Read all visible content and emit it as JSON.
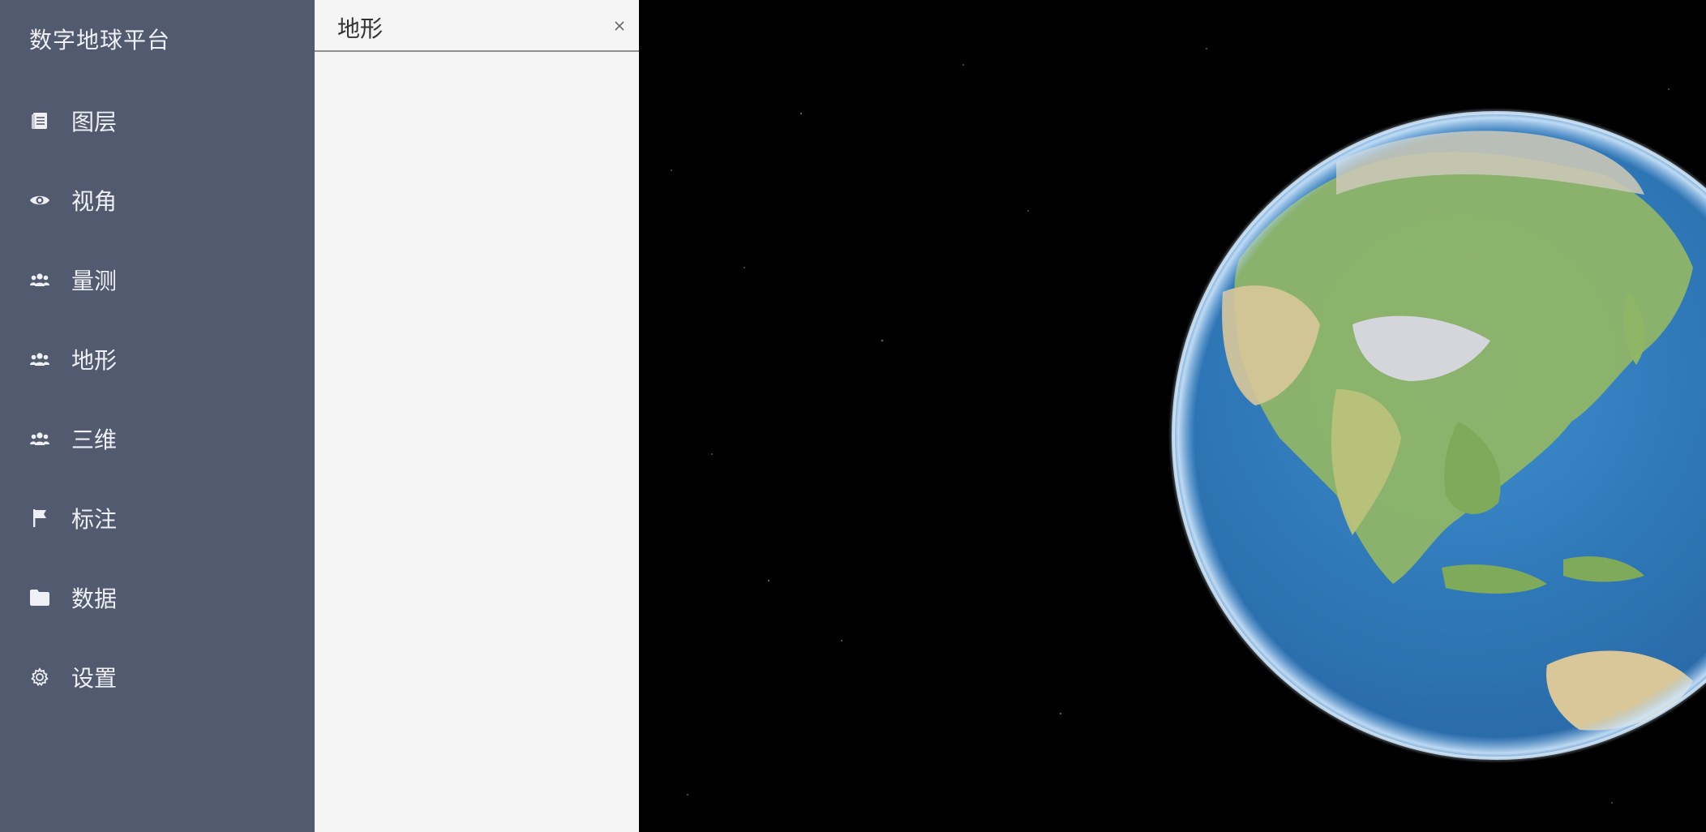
{
  "app": {
    "title": "数字地球平台"
  },
  "sidebar": {
    "items": [
      {
        "label": "图层",
        "icon": "layers-icon"
      },
      {
        "label": "视角",
        "icon": "eye-icon"
      },
      {
        "label": "量测",
        "icon": "users-icon"
      },
      {
        "label": "地形",
        "icon": "users-icon"
      },
      {
        "label": "三维",
        "icon": "users-icon"
      },
      {
        "label": "标注",
        "icon": "flag-icon"
      },
      {
        "label": "数据",
        "icon": "folder-icon"
      },
      {
        "label": "设置",
        "icon": "gear-icon"
      }
    ]
  },
  "panel": {
    "title": "地形",
    "close_icon": "close-icon"
  },
  "viewer": {
    "globe_icon": "globe"
  },
  "colors": {
    "sidebar_bg": "#515a6e",
    "panel_bg": "#f5f5f5",
    "viewer_bg": "#000000"
  }
}
